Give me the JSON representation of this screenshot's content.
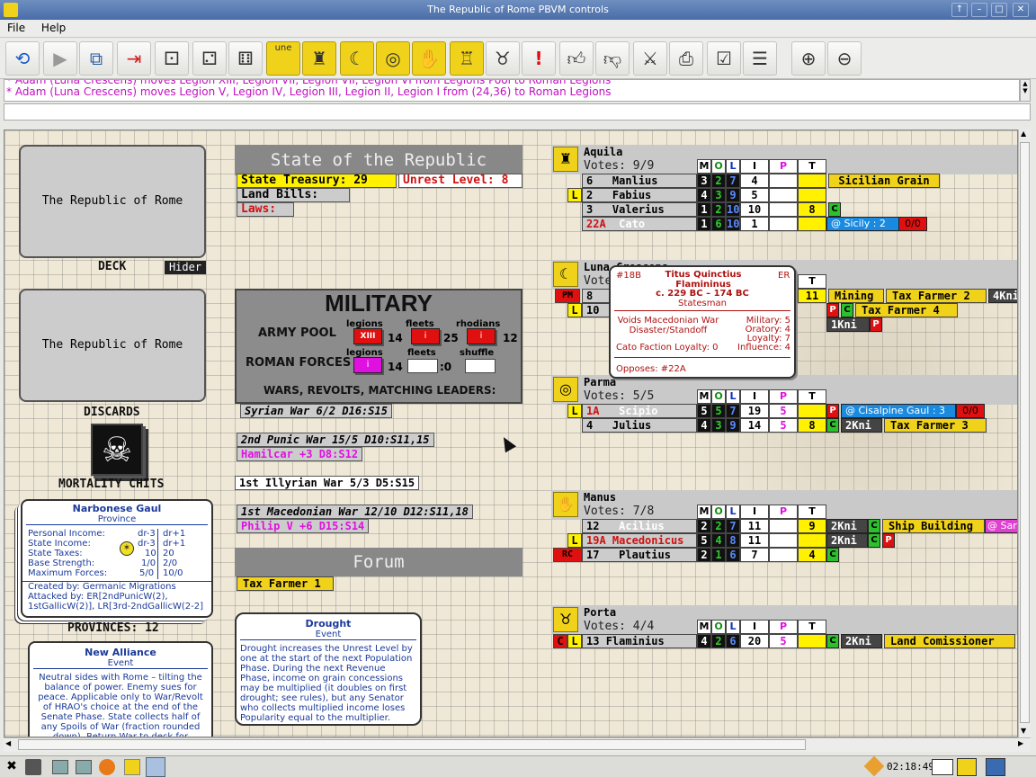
{
  "window": {
    "title": "The Republic of Rome PBVM controls"
  },
  "menu": {
    "file": "File",
    "help": "Help"
  },
  "toolbar": {
    "counter_text": "une"
  },
  "chat": {
    "line1": "* Adam (Luna Crescens) moves Legion XIII, Legion VII, Legion VII, Legion VI from Legions Pool to Roman Legions",
    "line2": "* Adam (Luna Crescens) moves Legion V, Legion IV, Legion III, Legion II, Legion I from (24,36) to Roman Legions"
  },
  "deck": {
    "card_text": "The Republic of Rome",
    "label": "DECK",
    "hider": "Hider"
  },
  "discards": {
    "card_text": "The Republic of Rome",
    "label": "DISCARDS"
  },
  "mortality": {
    "label": "MORTALITY CHITS"
  },
  "province": {
    "name": "Narbonese Gaul",
    "type": "Province",
    "rows": [
      [
        "Personal Income:",
        "dr-3",
        "dr+1"
      ],
      [
        "State Income:",
        "dr-3",
        "dr+1"
      ],
      [
        "State Taxes:",
        "10",
        "20"
      ],
      [
        "Base Strength:",
        "1/0",
        "2/0"
      ],
      [
        "Maximum Forces:",
        "5/0",
        "10/0"
      ]
    ],
    "created": "Created by: Germanic Migrations",
    "attacked": "Attacked by: ER[2ndPunicW(2), 1stGallicW(2)], LR[3rd-2ndGallicW(2-2]"
  },
  "provinces_label": "PROVINCES: 12",
  "new_alliance": {
    "title": "New Alliance",
    "type": "Event",
    "text": "Neutral sides with Rome – tilting the balance of power. Enemy sues for peace. Applicable only to War/Revolt of HRAO's choice at the end of the Senate Phase. State collects half of any Spoils of War (fraction rounded down). Return War to deck for reshuffle. Remove at start of next"
  },
  "state": {
    "header": "State of the Republic",
    "treasury": "State Treasury: 29",
    "unrest": "Unrest Level: 8",
    "land_bills": "Land Bills:",
    "laws": "Laws:"
  },
  "military": {
    "header": "MILITARY",
    "army_pool": "ARMY POOL",
    "roman_forces": "ROMAN FORCES",
    "legions": "legions",
    "fleets": "fleets",
    "rhodians": "rhodians",
    "shuffle": "shuffle",
    "pool_legions_token": "XIII",
    "pool_legions": "14",
    "pool_fleets": "25",
    "pool_rhodians": "12",
    "forces_legions": "14",
    "forces_fleets": ":0",
    "wars_header": "WARS, REVOLTS, MATCHING LEADERS:"
  },
  "wars": [
    {
      "name": "Syrian War 6/2 D16:S15"
    },
    {
      "name": "2nd Punic War 15/5 D10:S11,15"
    },
    {
      "name": "Hamilcar +3 D8:S12"
    },
    {
      "name": "1st Illyrian War 5/3 D5:S15"
    },
    {
      "name": "1st Macedonian War 12/10 D12:S11,18"
    },
    {
      "name": "Philip V +6 D15:S14"
    }
  ],
  "forum": {
    "header": "Forum",
    "tax_farmer": "Tax Farmer 1"
  },
  "drought": {
    "title": "Drought",
    "type": "Event",
    "text": "Drought increases the Unrest Level by one at the start of the next Population Phase. During the next Revenue Phase, income on grain concessions may be multiplied (it doubles on first drought; see rules), but any Senator who collects multiplied income loses Popularity equal to the multiplier."
  },
  "senate_headers": [
    "M",
    "O",
    "L",
    "I",
    "P",
    "T"
  ],
  "factions": [
    {
      "name": "Aquila",
      "votes": "Votes: 9/9",
      "senators": [
        {
          "id": "6",
          "name": "Manlius",
          "m": "3",
          "o": "2",
          "l": "7",
          "i": "4",
          "p": "",
          "t": ""
        },
        {
          "id": "2",
          "name": "Fabius",
          "m": "4",
          "o": "3",
          "l": "9",
          "i": "5",
          "p": "",
          "t": "",
          "tag": "L"
        },
        {
          "id": "3",
          "name": "Valerius",
          "m": "1",
          "o": "2",
          "l": "10",
          "i": "10",
          "p": "",
          "t": "8"
        },
        {
          "id": "22A",
          "name": "Cato",
          "m": "1",
          "o": "6",
          "l": "10",
          "i": "1",
          "p": "",
          "t": ""
        }
      ],
      "extras": {
        "conc1": "Sicilian Grain",
        "prov": "@ Sicily : 2",
        "prov_val": "0/0"
      }
    },
    {
      "name": "Luna Crescens",
      "votes": "Votes:",
      "senators": [
        {
          "id": "8",
          "name": "",
          "tag": "PM"
        },
        {
          "id": "10",
          "name": "",
          "tag": "L"
        }
      ],
      "extras": {
        "t": "11",
        "conc1": "Mining",
        "conc2": "Tax Farmer 2",
        "knights1": "4Kni",
        "conc3": "Tax Farmer 4",
        "knights2": "1Kni"
      }
    },
    {
      "name": "Parma",
      "votes": "Votes: 5/5",
      "senators": [
        {
          "id": "1A",
          "name": "Scipio",
          "m": "5",
          "o": "5",
          "l": "7",
          "i": "19",
          "p": "5",
          "t": "",
          "tag": "L"
        },
        {
          "id": "4",
          "name": "Julius",
          "m": "4",
          "o": "3",
          "l": "9",
          "i": "14",
          "p": "5",
          "t": "8"
        }
      ],
      "extras": {
        "prov": "@ Cisalpine Gaul : 3",
        "prov_val": "0/0",
        "knights": "2Kni",
        "conc": "Tax Farmer 3"
      }
    },
    {
      "name": "Manus",
      "votes": "Votes: 7/8",
      "senators": [
        {
          "id": "12",
          "name": "Acilius",
          "m": "2",
          "o": "2",
          "l": "7",
          "i": "11",
          "p": "",
          "t": "9"
        },
        {
          "id": "19A",
          "name": "Macedonicus",
          "m": "5",
          "o": "4",
          "l": "8",
          "i": "11",
          "p": "",
          "t": "",
          "tag": "L"
        },
        {
          "id": "17",
          "name": "Plautius",
          "m": "2",
          "o": "1",
          "l": "6",
          "i": "7",
          "p": "",
          "t": "4",
          "tag": "RC"
        }
      ],
      "extras": {
        "knights1": "2Kni",
        "conc": "Ship Building",
        "conc_extra": "@ Sar",
        "knights2": "2Kni"
      }
    },
    {
      "name": "Porta",
      "votes": "Votes: 4/4",
      "senators": [
        {
          "id": "13",
          "name": "Flaminius",
          "m": "4",
          "o": "2",
          "l": "6",
          "i": "20",
          "p": "5",
          "t": "",
          "tag": "L",
          "tag2": "C"
        }
      ],
      "extras": {
        "knights": "2Kni",
        "conc": "Land Comissioner"
      }
    }
  ],
  "popup": {
    "id": "#18B",
    "name": "Titus Quinctius Flamininus",
    "dates": "c. 229 BC – 174 BC",
    "role": "Statesman",
    "era": "ER",
    "ability": "Voids Macedonian War Disaster/Standoff",
    "stats": [
      "Military: 5",
      "Oratory: 4",
      "Loyalty: 7",
      "Influence: 4"
    ],
    "loyalty_note": "Cato Faction Loyalty: 0",
    "opposes": "Opposes: #22A"
  },
  "taskbar": {
    "clock": "02:18:49"
  }
}
